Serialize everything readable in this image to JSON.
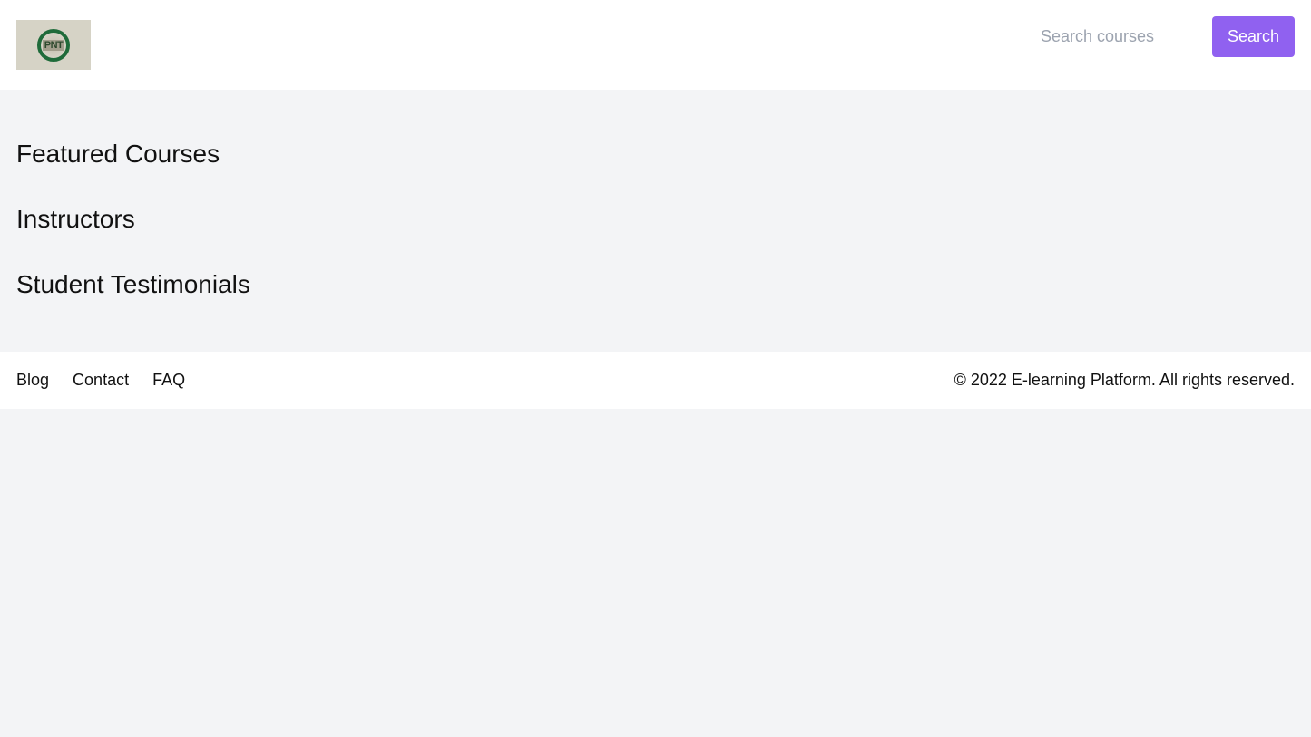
{
  "header": {
    "logo_alt": "PNT logo",
    "logo_text": "PNT",
    "search": {
      "placeholder": "Search courses",
      "value": "",
      "button_label": "Search"
    }
  },
  "main": {
    "sections": [
      {
        "title": "Featured Courses"
      },
      {
        "title": "Instructors"
      },
      {
        "title": "Student Testimonials"
      }
    ]
  },
  "footer": {
    "links": [
      {
        "label": "Blog"
      },
      {
        "label": "Contact"
      },
      {
        "label": "FAQ"
      }
    ],
    "copyright": "© 2022 E-learning Platform. All rights reserved."
  },
  "colors": {
    "accent": "#9061f0",
    "background": "#f3f4f6",
    "surface": "#ffffff"
  }
}
